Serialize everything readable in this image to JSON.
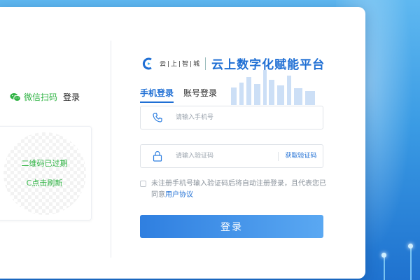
{
  "qr_panel": {
    "title_wechat": "微信扫码",
    "title_login": "登录",
    "expired_text": "二维码已过期",
    "refresh_text": "C点击刷新"
  },
  "brand": {
    "small_text": "云|上|智|城",
    "platform_name": "云上数字化赋能平台"
  },
  "tabs": [
    {
      "label": "手机登录",
      "active": true
    },
    {
      "label": "账号登录",
      "active": false
    }
  ],
  "phone_field": {
    "placeholder": "请输入手机号",
    "value": ""
  },
  "code_field": {
    "placeholder": "请输入验证码",
    "value": "",
    "action_label": "获取验证码"
  },
  "agreement": {
    "text": "未注册手机号输入验证码后将自动注册登录，且代表您已同意",
    "link_label": "用户协议",
    "checked": false
  },
  "login_button": {
    "label": "登录"
  },
  "colors": {
    "accent": "#1f6fd4",
    "wechat_green": "#2fb343",
    "background": "#3a9be4"
  }
}
